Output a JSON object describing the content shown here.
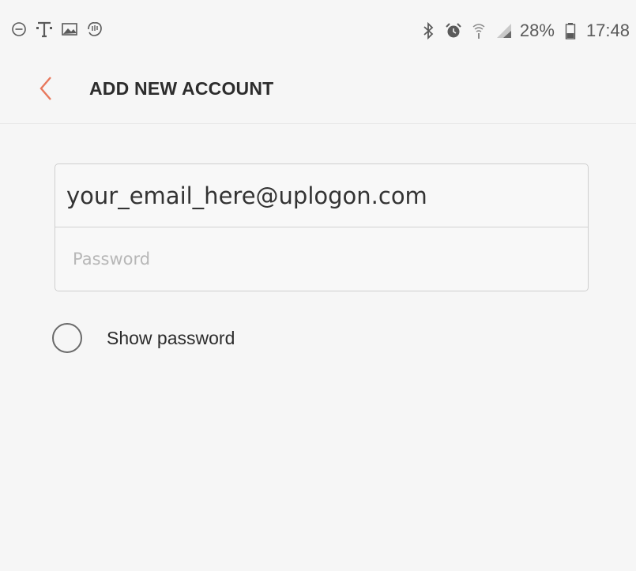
{
  "status_bar": {
    "left_icons": [
      "minus-circle-icon",
      "t-mobile-icon",
      "image-icon",
      "hand-icon"
    ],
    "right_icons": [
      "bluetooth-icon",
      "alarm-icon",
      "wifi-calling-icon",
      "signal-icon",
      "battery-icon"
    ],
    "battery": "28%",
    "time": "17:48"
  },
  "app_bar": {
    "title": "ADD NEW ACCOUNT",
    "back_color": "#e8785c"
  },
  "form": {
    "email_value": "your_email_here@uplogon.com",
    "password_placeholder": "Password",
    "show_password_label": "Show password",
    "show_password_checked": false
  }
}
